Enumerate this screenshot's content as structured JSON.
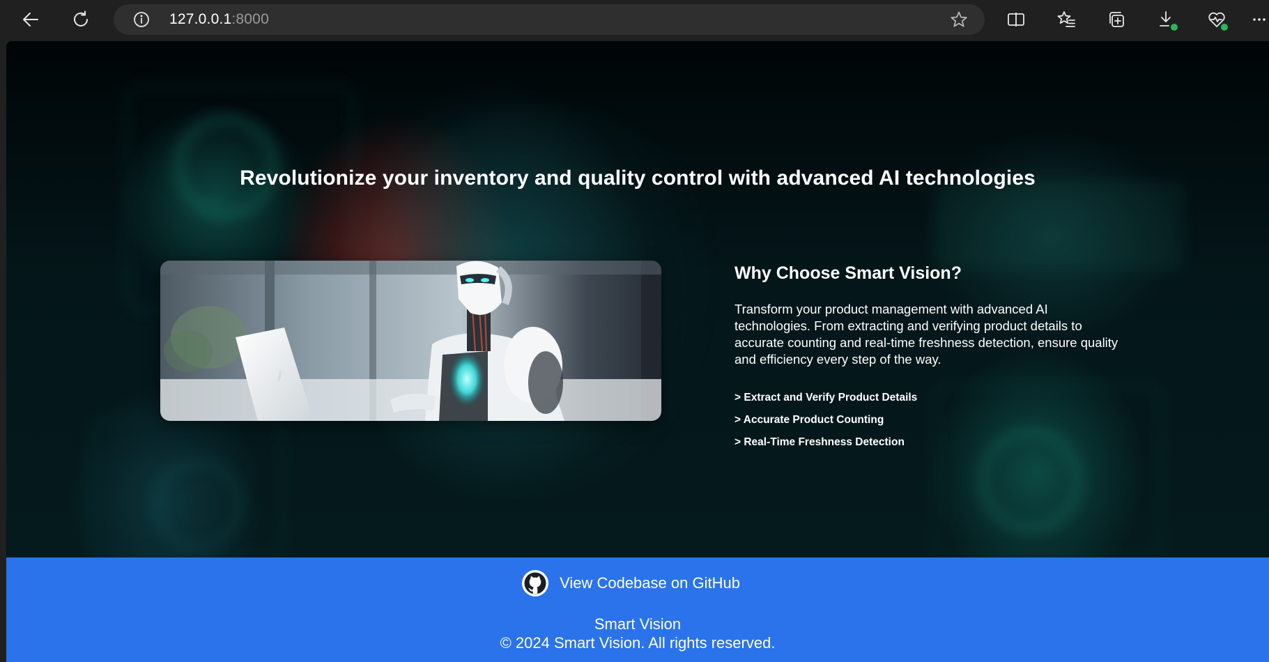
{
  "browser": {
    "url_host": "127.0.0.1",
    "url_port": ":8000",
    "icons": [
      "back-arrow-icon",
      "refresh-icon",
      "site-info-icon",
      "favorite-star-icon",
      "split-screen-icon",
      "favorites-icon",
      "collections-icon",
      "downloads-icon",
      "browser-essentials-icon",
      "more-icon"
    ]
  },
  "hero": {
    "title": "Revolutionize your inventory and quality control with advanced AI technologies",
    "image_alt": "AI robot working on a laptop"
  },
  "features": {
    "heading": "Why Choose Smart Vision?",
    "description": "Transform your product management with advanced AI technologies. From extracting and verifying product details to accurate counting and real-time freshness detection, ensure quality and efficiency every step of the way.",
    "items": [
      "> Extract and Verify Product Details",
      "> Accurate Product Counting",
      "> Real-Time Freshness Detection"
    ]
  },
  "footer": {
    "github_label": "View Codebase on GitHub",
    "brand": "Smart Vision",
    "copyright": "© 2024 Smart Vision. All rights reserved.",
    "background_color": "#2a73ea"
  }
}
